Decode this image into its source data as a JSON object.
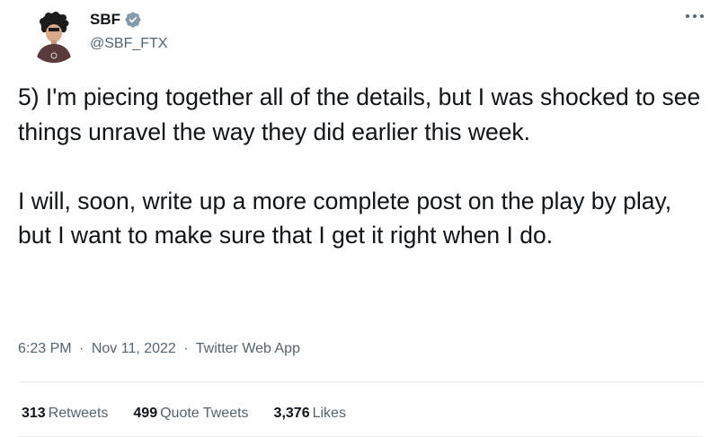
{
  "tweet": {
    "display_name": "SBF",
    "handle": "@SBF_FTX",
    "text": "5) I'm piecing together all of the details, but I was shocked to see things unravel the way they did earlier this week.\n\nI will, soon, write up a more complete post on the play by play, but I want to make sure that I get it right when I do.",
    "time": "6:23 PM",
    "date": "Nov 11, 2022",
    "source": "Twitter Web App",
    "separator": "·"
  },
  "stats": {
    "retweets_count": "313",
    "retweets_label": "Retweets",
    "quotes_count": "499",
    "quotes_label": "Quote Tweets",
    "likes_count": "3,376",
    "likes_label": "Likes"
  },
  "icons": {
    "verified": "verified-badge-icon",
    "more": "more-horizontal-icon",
    "avatar": "avatar-image"
  },
  "colors": {
    "text": "#0f1419",
    "secondary": "#536471",
    "verified_badge": "#1d9bf0",
    "divider": "#e7e9ea"
  }
}
